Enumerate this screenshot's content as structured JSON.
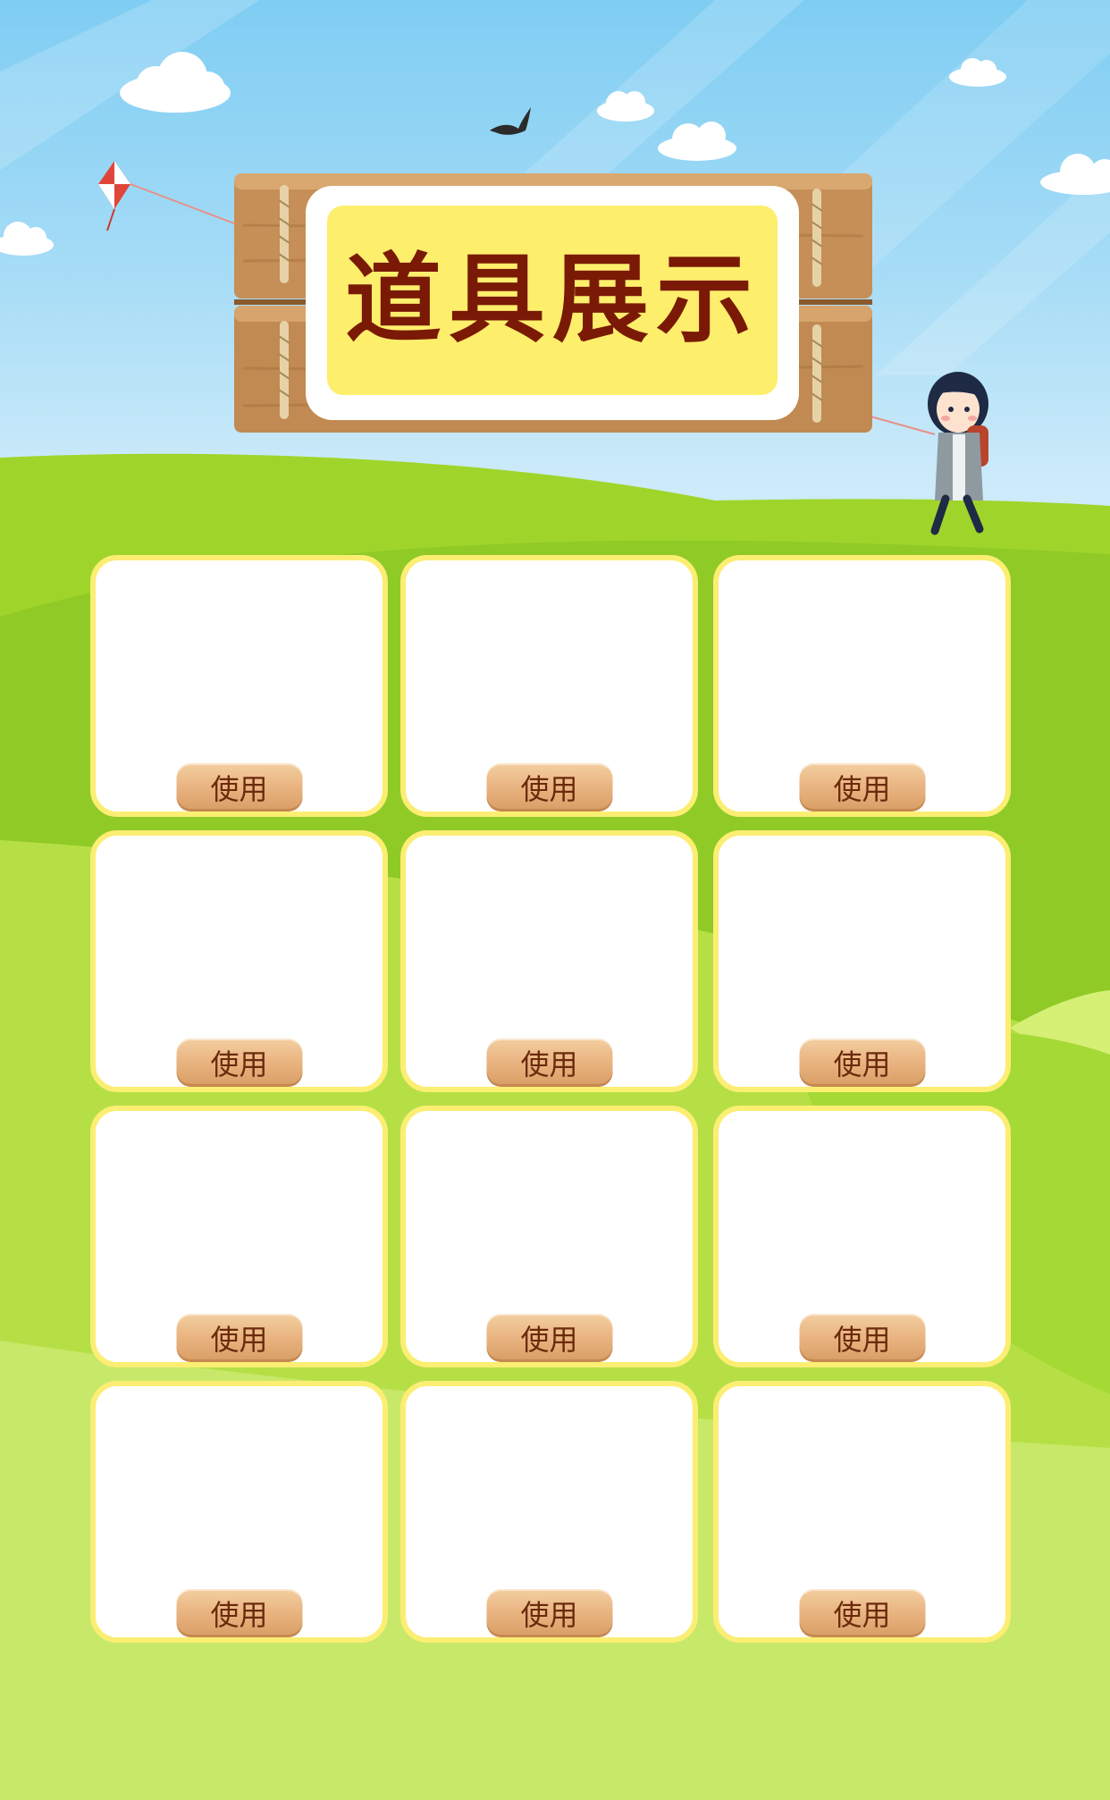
{
  "title": "道具展示",
  "items": [
    {
      "button_label": "使用"
    },
    {
      "button_label": "使用"
    },
    {
      "button_label": "使用"
    },
    {
      "button_label": "使用"
    },
    {
      "button_label": "使用"
    },
    {
      "button_label": "使用"
    },
    {
      "button_label": "使用"
    },
    {
      "button_label": "使用"
    },
    {
      "button_label": "使用"
    },
    {
      "button_label": "使用"
    },
    {
      "button_label": "使用"
    },
    {
      "button_label": "使用"
    }
  ],
  "colors": {
    "sky": "#7fcdf3",
    "grass": "#a2d92f",
    "sign_plate": "#fdee6c",
    "title_text": "#7a1a06",
    "card_border": "#fbee73",
    "button": "#e7b17d"
  }
}
